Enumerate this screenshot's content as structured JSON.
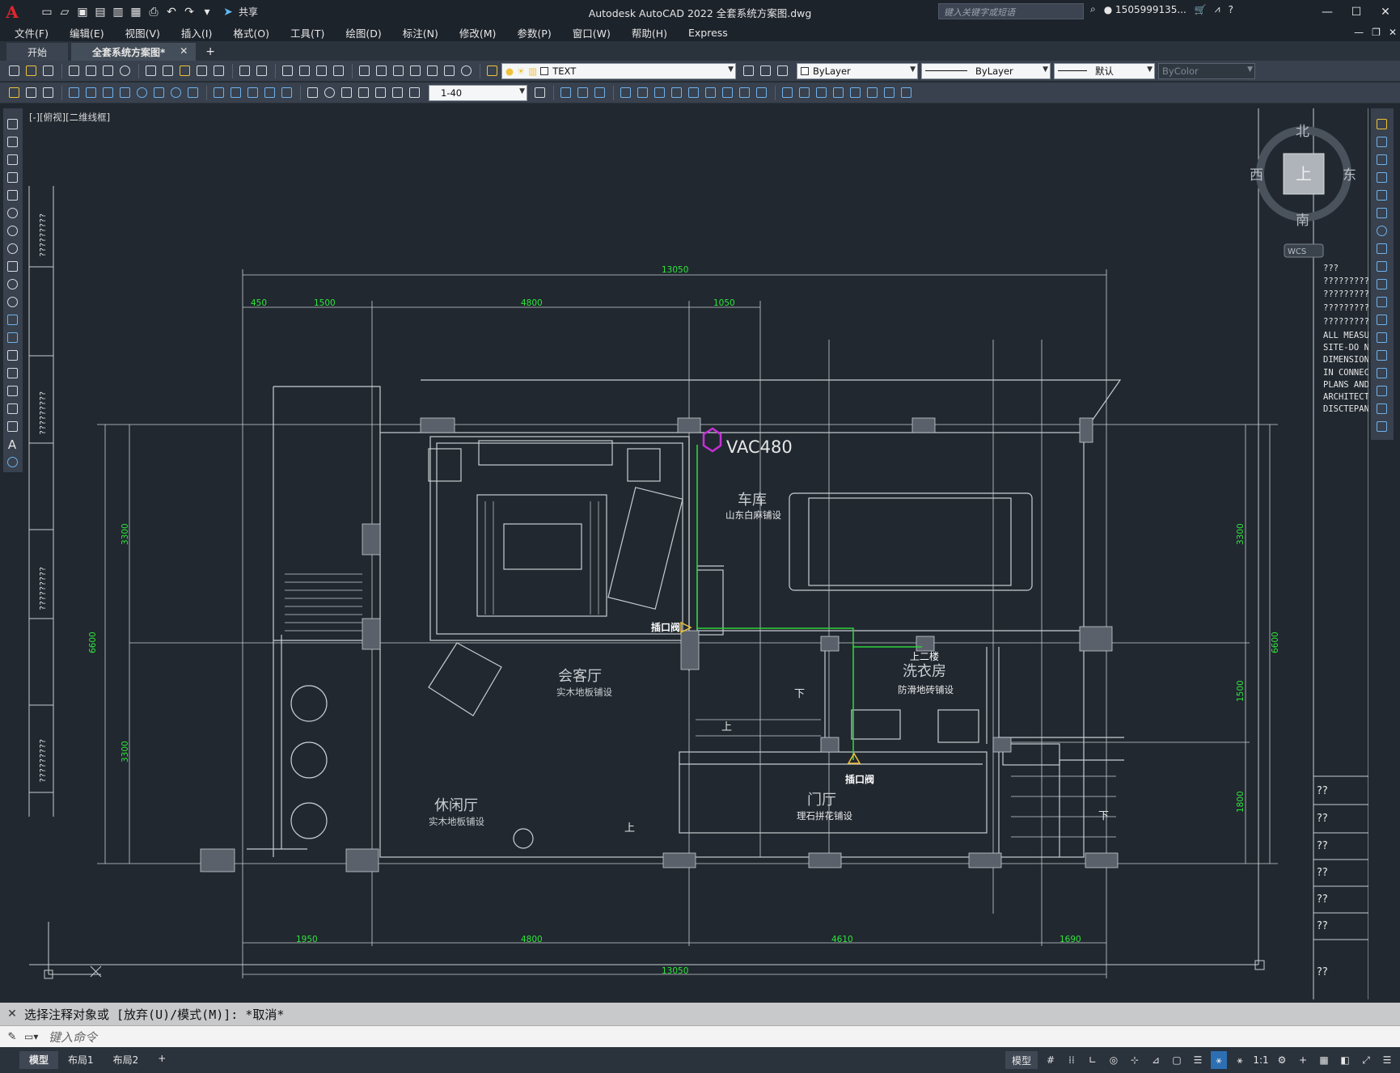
{
  "app": {
    "title": "Autodesk AutoCAD 2022    全套系统方案图.dwg",
    "logo": "A",
    "share_label": "共享",
    "search_placeholder": "键入关键字或短语",
    "user": "1505999135...",
    "window_controls": [
      "—",
      "☐",
      "✕"
    ]
  },
  "menu": {
    "items": [
      "文件(F)",
      "编辑(E)",
      "视图(V)",
      "插入(I)",
      "格式(O)",
      "工具(T)",
      "绘图(D)",
      "标注(N)",
      "修改(M)",
      "参数(P)",
      "窗口(W)",
      "帮助(H)",
      "Express"
    ]
  },
  "tabs": {
    "items": [
      {
        "label": "开始"
      },
      {
        "label": "全套系统方案图*"
      }
    ],
    "add_label": "+",
    "close_label": "✕"
  },
  "toolbar": {
    "layer_name": "TEXT",
    "color": "ByLayer",
    "linetype": "ByLayer",
    "lineweight": "默认",
    "plotstyle": "ByColor",
    "scale": "1-40"
  },
  "viewport": {
    "label": "[-][俯视][二维线框]",
    "compass": {
      "north": "北",
      "south": "南",
      "east": "东",
      "west": "西",
      "top": "上",
      "wcs": "WCS"
    }
  },
  "drawing": {
    "dims_top": {
      "overall": "13050",
      "segments": [
        "450",
        "1500",
        "4800",
        "1050"
      ]
    },
    "dims_bottom": {
      "overall": "13050",
      "segments": [
        "1950",
        "4800",
        "4610",
        "1690"
      ]
    },
    "dims_left": {
      "overall": "6600",
      "segments": [
        "3300",
        "3300"
      ]
    },
    "dims_right": {
      "overall": "6600",
      "segments": [
        "3300",
        "1500",
        "1800"
      ]
    },
    "rooms": [
      {
        "name": "车库",
        "note": "山东白麻铺设"
      },
      {
        "name": "会客厅",
        "note": "实木地板铺设"
      },
      {
        "name": "休闲厅",
        "note": "实木地板铺设"
      },
      {
        "name": "洗衣房",
        "note": "防滑地砖铺设"
      },
      {
        "name": "门厅",
        "note": "理石拼花铺设"
      }
    ],
    "equipment_label": "VAC480",
    "outlet_labels": [
      "插口阀",
      "插口阀"
    ],
    "stairs_labels": {
      "up1": "上",
      "down1": "下",
      "up2": "上",
      "up3": "上",
      "down2": "下",
      "up_level": "上二楼"
    },
    "left_note_marks": [
      "?????????",
      "?????????",
      "?????????",
      "?????????",
      "?????????"
    ],
    "right_notes": [
      "???",
      "??????????",
      "??????????",
      "??????????",
      "??????????",
      "ALL MEASUR",
      "SITE-DO NO",
      "DIMENSIONS",
      "IN CONNECT",
      "PLANS AND",
      "ARCHITECT",
      "DISCTEPANC"
    ],
    "right_table": [
      "??",
      "??",
      "??",
      "??",
      "??",
      "??",
      "??"
    ]
  },
  "command": {
    "history": "选择注释对象或 [放弃(U)/模式(M)]: *取消*",
    "placeholder": "键入命令"
  },
  "status": {
    "layout_tabs": [
      {
        "label": "模型"
      },
      {
        "label": "布局1"
      },
      {
        "label": "布局2"
      }
    ],
    "add_label": "+",
    "model_label": "模型",
    "scale_label": "1:1"
  },
  "colors": {
    "bg": "#212830",
    "linework": "#c9cdd1",
    "dim_text": "#2ee63a",
    "accent_magenta": "#c630d6",
    "pipe_green": "#2fd23a"
  }
}
